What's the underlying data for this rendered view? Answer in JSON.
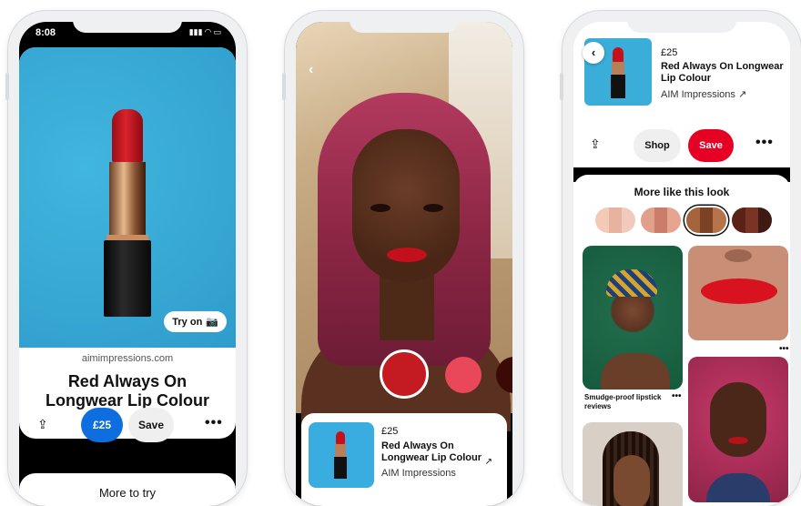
{
  "phone1": {
    "status": {
      "time": "8:08"
    },
    "try_on_label": "Try on",
    "site": "aimimpressions.com",
    "title": "Red Always On Longwear Lip Colour",
    "price_button": "£25",
    "save_button": "Save",
    "footer_label": "More to try"
  },
  "phone2": {
    "price": "£25",
    "title": "Red Always On Longwear Lip Colour",
    "brand": "AIM Impressions",
    "shades": [
      "#c41a22",
      "#e8485a",
      "#3b0a06"
    ]
  },
  "phone3": {
    "price": "£25",
    "title": "Red Always On Longwear Lip Colour",
    "brand": "AIM Impressions",
    "shop_button": "Shop",
    "save_button": "Save",
    "section_title": "More like this look",
    "looks": [
      [
        "#f3c9b8",
        "#e7b2a0",
        "#f0cbbd"
      ],
      [
        "#e0a08a",
        "#c97d6a",
        "#e5a590"
      ],
      [
        "#a5643c",
        "#7b4226",
        "#b7744a"
      ],
      [
        "#5a2217",
        "#7a3426",
        "#3e1a12"
      ]
    ],
    "tile_caption": "Smudge-proof lipstick reviews"
  },
  "colors": {
    "save_red": "#e60023",
    "price_blue": "#0e6ee0",
    "lipstick_blue": "#3aaed8"
  }
}
